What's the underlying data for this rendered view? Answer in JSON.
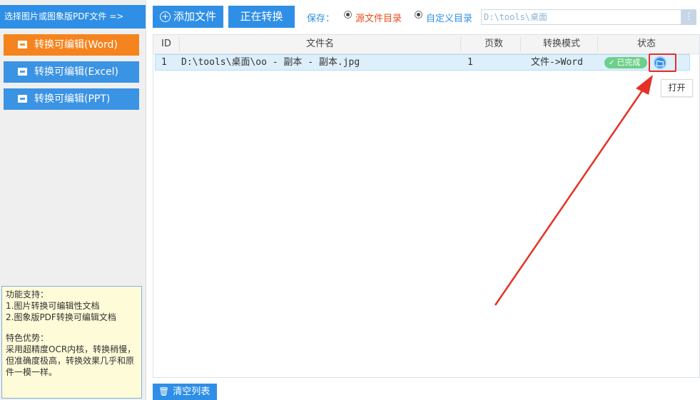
{
  "sidebar": {
    "banner": "选择图片或图象版PDF文件 =>",
    "buttons": [
      {
        "label": "转换可编辑(Word)",
        "color": "#f5841f"
      },
      {
        "label": "转换可编辑(Excel)",
        "color": "#3b93e4"
      },
      {
        "label": "转换可编辑(PPT)",
        "color": "#3b93e4"
      }
    ],
    "info": {
      "features_title": "功能支持：",
      "features": [
        "1.图片转换可编辑性文档",
        "2.图象版PDF转换可编辑文档"
      ],
      "advantages_title": "特色优势：",
      "advantages_text": "采用超精度OCR内核，转换稍慢，但准确度极高，转换效果几乎和原件一模一样。"
    }
  },
  "toolbar": {
    "add_file_label": "添加文件",
    "converting_label": "正在转换",
    "save_label": "保存：",
    "radio_source_label": "源文件目录",
    "radio_custom_label": "自定义目录",
    "selected_radio": "source",
    "path_value": "D:\\tools\\桌面",
    "path_more_icon": "⋮"
  },
  "table": {
    "headers": {
      "id": "ID",
      "filename": "文件名",
      "pages": "页数",
      "mode": "转换模式",
      "status": "状态"
    },
    "rows": [
      {
        "id": "1",
        "filename": "D:\\tools\\桌面\\oo - 副本 - 副本.jpg",
        "pages": "1",
        "mode": "文件->Word",
        "status": "已完成"
      }
    ]
  },
  "tooltip": {
    "open_label": "打开"
  },
  "footer": {
    "clear_list_label": "清空列表"
  },
  "colors": {
    "accent": "#2f8fe6",
    "word": "#f5841f",
    "success": "#6dd08a",
    "annotation": "#e53226"
  }
}
